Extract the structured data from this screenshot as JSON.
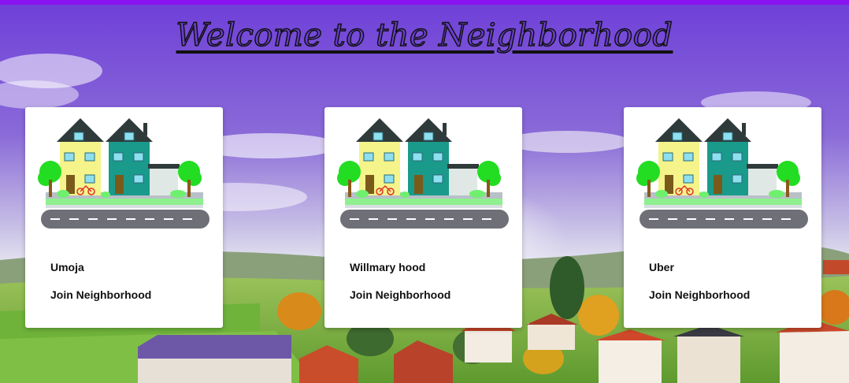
{
  "header": {
    "title": "Welcome to the Neighborhood"
  },
  "colors": {
    "top_bar": "#8a12f0",
    "sky": "#7b4fd6",
    "card_bg": "#ffffff"
  },
  "neighborhoods": [
    {
      "name": "Umoja",
      "action_label": "Join Neighborhood",
      "image_icon": "houses-street-illustration"
    },
    {
      "name": "Willmary hood",
      "action_label": "Join Neighborhood",
      "image_icon": "houses-street-illustration"
    },
    {
      "name": "Uber",
      "action_label": "Join Neighborhood",
      "image_icon": "houses-street-illustration"
    }
  ]
}
